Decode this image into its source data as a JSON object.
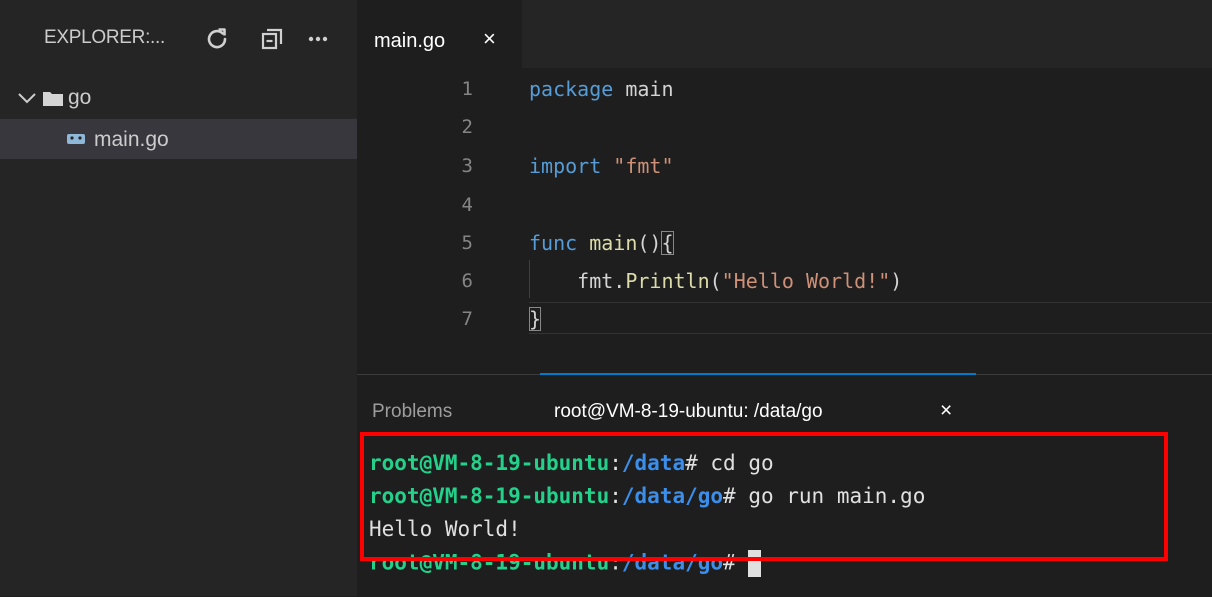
{
  "sidebar": {
    "title": "EXPLORER:...",
    "actions": [
      {
        "icon": "refresh-icon"
      },
      {
        "icon": "collapse-all-icon"
      },
      {
        "icon": "more-icon"
      }
    ],
    "tree": [
      {
        "label": "go",
        "type": "folder",
        "icon": "folder-icon",
        "expander": "chevron-down-icon"
      },
      {
        "label": "main.go",
        "type": "file",
        "icon": "go-file-icon",
        "selected": true
      }
    ]
  },
  "editor": {
    "tab": {
      "label": "main.go",
      "close": "×"
    },
    "line_numbers": [
      "1",
      "2",
      "3",
      "4",
      "5",
      "6",
      "7"
    ],
    "code": {
      "line1_kw": "package",
      "line1_rest": " main",
      "line3_kw": "import",
      "line3_str": "\"fmt\"",
      "line5_kw": "func",
      "line5_fn": "main",
      "line5_parens": "()",
      "line5_brace": "{",
      "line6_pkg": "    fmt.",
      "line6_fn": "Println",
      "line6_open": "(",
      "line6_str": "\"Hello World!\"",
      "line6_close": ")",
      "line7_brace": "}"
    }
  },
  "panel": {
    "tabs": [
      {
        "label": "Problems",
        "active": false
      },
      {
        "label": "root@VM-8-19-ubuntu: /data/go",
        "active": true
      }
    ],
    "tab_close": "×",
    "terminal": [
      {
        "user": "root@VM-8-19-ubuntu",
        "sep": ":",
        "path": "/data",
        "prompt": "# ",
        "cmd": "cd go"
      },
      {
        "user": "root@VM-8-19-ubuntu",
        "sep": ":",
        "path": "/data/go",
        "prompt": "# ",
        "cmd": "go run main.go"
      },
      {
        "output": "Hello World!"
      },
      {
        "user": "root@VM-8-19-ubuntu",
        "sep": ":",
        "path": "/data/go",
        "prompt": "# ",
        "cmd": ""
      }
    ]
  },
  "colors": {
    "highlight": "#ff0000",
    "terminal_user": "#23d18b",
    "terminal_path": "#3b8eea",
    "keyword": "#569cd6",
    "function": "#dcdcaa",
    "string": "#ce9178"
  }
}
